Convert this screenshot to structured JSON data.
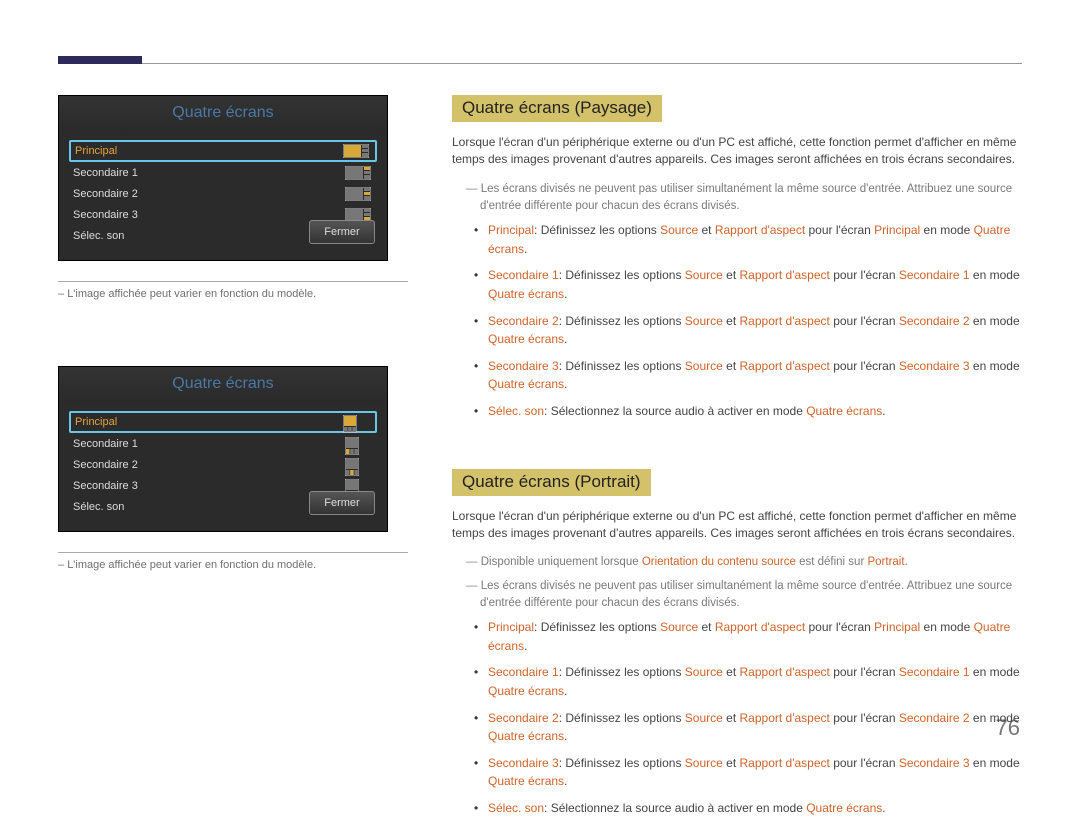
{
  "page_number": "76",
  "osd": {
    "title": "Quatre écrans",
    "rows": {
      "primary": "Principal",
      "sec1": "Secondaire 1",
      "sec2": "Secondaire 2",
      "sec3": "Secondaire 3",
      "sound": "Sélec. son"
    },
    "close_label": "Fermer"
  },
  "left_note": "L'image affichée peut varier en fonction du modèle.",
  "sections": {
    "landscape": {
      "title": "Quatre écrans (Paysage)",
      "intro": "Lorsque l'écran d'un périphérique externe ou d'un PC est affiché, cette fonction permet d'afficher en même temps des images provenant d'autres appareils. Ces images seront affichées en trois écrans secondaires.",
      "note1": "Les écrans divisés ne peuvent pas utiliser simultanément la même source d'entrée. Attribuez une source d'entrée différente pour chacun des écrans divisés."
    },
    "portrait": {
      "title": "Quatre écrans (Portrait)",
      "intro": "Lorsque l'écran d'un périphérique externe ou d'un PC est affiché, cette fonction permet d'afficher en même temps des images provenant d'autres appareils. Ces images seront affichées en trois écrans secondaires.",
      "avail_a": "Disponible uniquement lorsque ",
      "avail_b": "Orientation du contenu source",
      "avail_c": " est défini sur ",
      "avail_d": "Portrait",
      "note1": "Les écrans divisés ne peuvent pas utiliser simultanément la même source d'entrée. Attribuez une source d'entrée différente pour chacun des écrans divisés."
    }
  },
  "bullet_texts": {
    "principal_a": "Principal",
    "principal_b": ": Définissez les options ",
    "source": "Source",
    "et": " et ",
    "rapport": "Rapport d'aspect",
    "pour_ecran": " pour l'écran ",
    "en_mode": " en mode ",
    "quatre_ecrans": "Quatre écrans",
    "secondaire1": "Secondaire 1",
    "secondaire2": "Secondaire 2",
    "secondaire3": "Secondaire 3",
    "selec_son": "Sélec. son",
    "selec_son_text": ": Sélectionnez la source audio à activer en mode ",
    "period": "."
  }
}
